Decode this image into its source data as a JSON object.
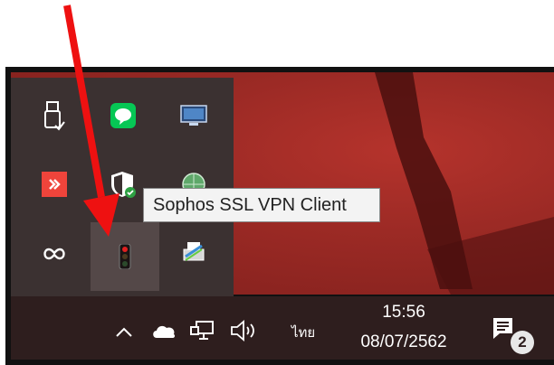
{
  "tooltip": {
    "text": "Sophos SSL VPN Client"
  },
  "taskbar": {
    "time": "15:56",
    "date": "08/07/2562",
    "language": "ไทย",
    "notification_count": "2"
  },
  "tray_icons": [
    "usb-eject-icon",
    "line-messenger-icon",
    "monitor-app-icon",
    "anydesk-icon",
    "windows-security-icon",
    "network-globe-icon",
    "creative-cloud-icon",
    "sophos-traffic-light-icon",
    "printer-app-icon"
  ],
  "colors": {
    "annotation_arrow": "#ee1111",
    "taskbar": "#2e1e1e",
    "tray_popup": "#3b3131"
  }
}
